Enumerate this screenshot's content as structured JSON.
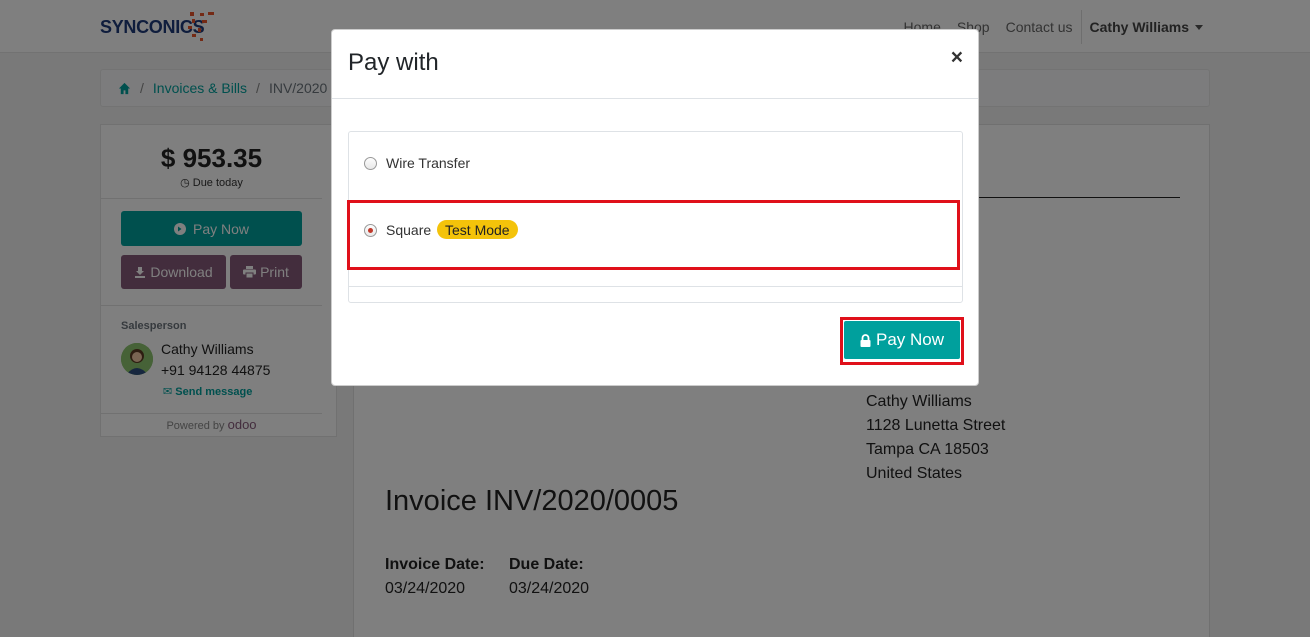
{
  "brand": {
    "logo_text": "SYNCONICS"
  },
  "nav": {
    "links": [
      "Home",
      "Shop",
      "Contact us"
    ],
    "user": "Cathy Williams"
  },
  "breadcrumb": {
    "items": [
      "Invoices & Bills",
      "INV/2020"
    ]
  },
  "sidebar": {
    "amount": "$ 953.35",
    "due": "Due today",
    "pay_now": "Pay Now",
    "download": "Download",
    "print": "Print",
    "salesperson_label": "Salesperson",
    "salesperson_name": "Cathy Williams",
    "salesperson_phone": "+91 94128 44875",
    "send_message": "Send message",
    "powered_by": "Powered by",
    "powered_brand": "odoo"
  },
  "document": {
    "address": [
      "Cathy Williams",
      "1128 Lunetta Street",
      "Tampa CA 18503",
      "United States"
    ],
    "title": "Invoice INV/2020/0005",
    "invoice_date_label": "Invoice Date:",
    "invoice_date": "03/24/2020",
    "due_date_label": "Due Date:",
    "due_date": "03/24/2020"
  },
  "modal": {
    "title": "Pay with",
    "close": "×",
    "options": [
      {
        "label": "Wire Transfer",
        "selected": false
      },
      {
        "label": "Square",
        "selected": true,
        "badge": "Test Mode"
      }
    ],
    "pay_button": "Pay Now"
  },
  "colors": {
    "accent": "#00a09d",
    "purple": "#875a7b",
    "highlight": "#e0101a",
    "badge": "#f4c30a"
  }
}
